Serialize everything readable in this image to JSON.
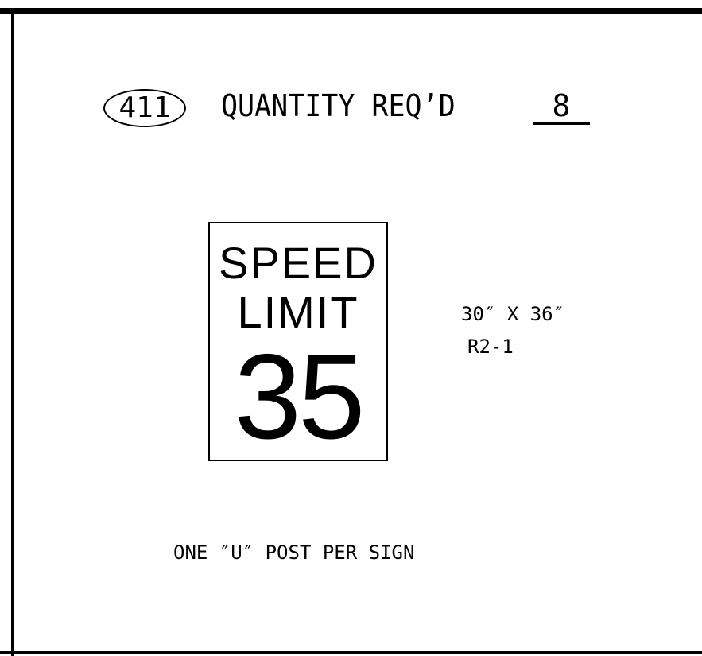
{
  "header": {
    "item_number": "411",
    "quantity_label": "QUANTITY REQ’D",
    "quantity_value": "8"
  },
  "sign": {
    "line1": "SPEED",
    "line2": "LIMIT",
    "number": "35"
  },
  "sign_info": {
    "size": "30″ X 36″",
    "code": "R2-1"
  },
  "notes": {
    "post": "ONE ″U″ POST PER SIGN"
  }
}
